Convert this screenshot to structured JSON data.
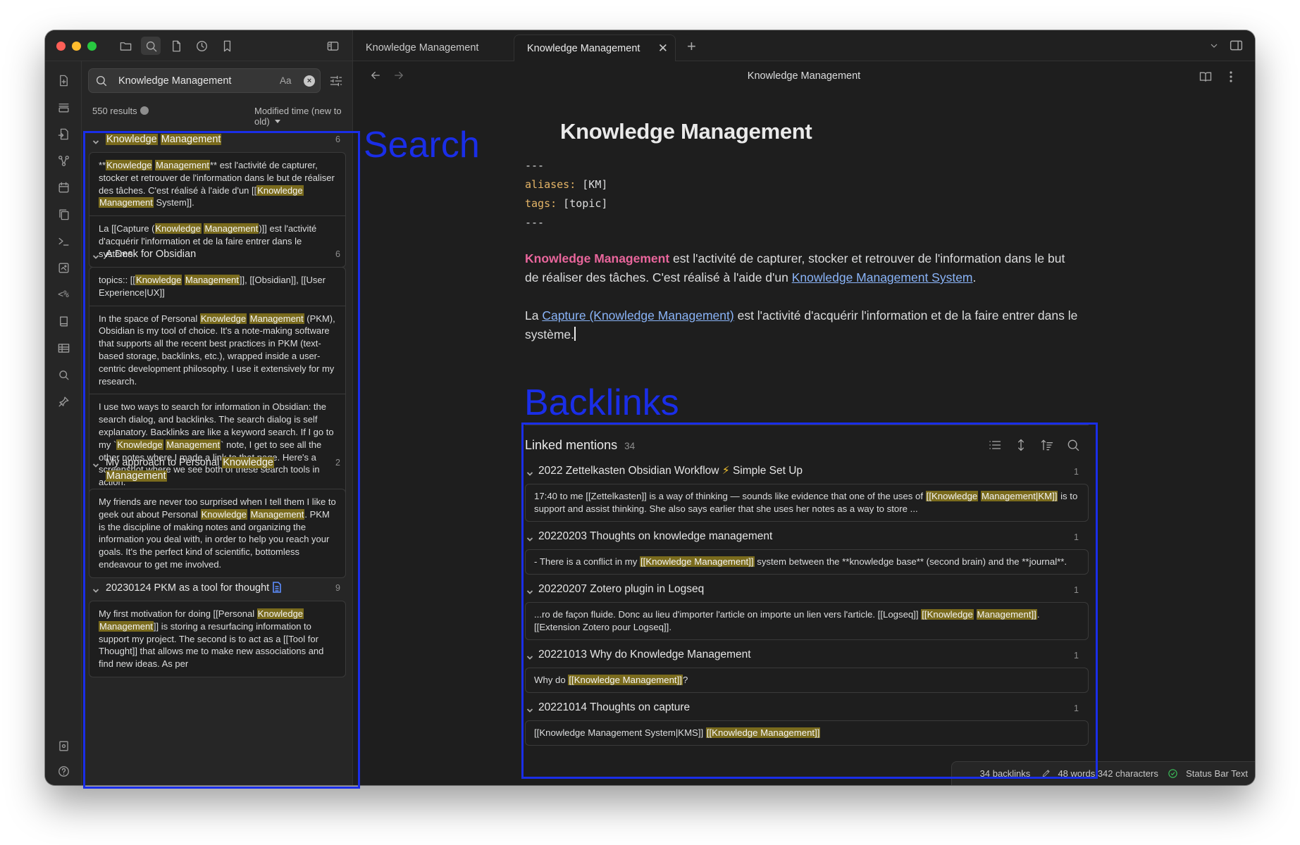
{
  "window": {
    "traffic_lights": [
      "close",
      "minimize",
      "zoom"
    ]
  },
  "toolbar_icons": [
    "folder-icon",
    "search-icon",
    "file-icon",
    "clock-icon",
    "bookmark-icon",
    "sidebar-toggle-icon"
  ],
  "ribbon_icons": [
    "new-note-icon",
    "stack-icon",
    "file-import-icon",
    "graph-icon",
    "calendar-icon",
    "copy-icon",
    "terminal-icon",
    "image-icon",
    "template-icon",
    "book-icon",
    "table-icon",
    "search-icon",
    "pin-icon",
    "vault-icon",
    "help-icon",
    "settings-icon"
  ],
  "search": {
    "query": "Knowledge Management",
    "match_case_label": "Aa",
    "results_count": "550 results",
    "sort_label": "Modified time (new to old)",
    "groups": [
      {
        "title_parts": [
          {
            "hl": true,
            "t": "Knowledge"
          },
          {
            "hl": false,
            "t": " "
          },
          {
            "hl": true,
            "t": "Management"
          }
        ],
        "count": "6",
        "matches": [
          [
            {
              "hl": false,
              "t": "**"
            },
            {
              "hl": true,
              "t": "Knowledge"
            },
            {
              "hl": false,
              "t": " "
            },
            {
              "hl": true,
              "t": "Management"
            },
            {
              "hl": false,
              "t": "** est l'activité de capturer, stocker et retrouver de l'information dans le but de réaliser des tâches. C'est réalisé à l'aide d'un [["
            },
            {
              "hl": true,
              "t": "Knowledge"
            },
            {
              "hl": false,
              "t": " "
            },
            {
              "hl": true,
              "t": "Management"
            },
            {
              "hl": false,
              "t": " System]]."
            }
          ],
          [
            {
              "hl": false,
              "t": "La [[Capture ("
            },
            {
              "hl": true,
              "t": "Knowledge"
            },
            {
              "hl": false,
              "t": " "
            },
            {
              "hl": true,
              "t": "Management"
            },
            {
              "hl": false,
              "t": ")]] est l'activité d'acquérir l'information et de la faire entrer dans le système."
            }
          ]
        ]
      },
      {
        "title_parts": [
          {
            "hl": false,
            "t": "A Desk for Obsidian"
          }
        ],
        "count": "6",
        "matches": [
          [
            {
              "hl": false,
              "t": "topics:: [["
            },
            {
              "hl": true,
              "t": "Knowledge"
            },
            {
              "hl": false,
              "t": " "
            },
            {
              "hl": true,
              "t": "Management"
            },
            {
              "hl": false,
              "t": "]], [[Obsidian]], [[User Experience|UX]]"
            }
          ],
          [
            {
              "hl": false,
              "t": "In the space of Personal "
            },
            {
              "hl": true,
              "t": "Knowledge"
            },
            {
              "hl": false,
              "t": " "
            },
            {
              "hl": true,
              "t": "Management"
            },
            {
              "hl": false,
              "t": " (PKM), Obsidian is my tool of choice. It's a note-making software that supports all the recent best practices in PKM (text-based storage, backlinks, etc.), wrapped inside a user-centric development philosophy. I use it extensively for my research."
            }
          ],
          [
            {
              "hl": false,
              "t": "I use two ways to search for information in Obsidian: the search dialog, and backlinks. The search dialog is self explanatory. Backlinks are like a keyword search. If I go to my `"
            },
            {
              "hl": true,
              "t": "Knowledge"
            },
            {
              "hl": false,
              "t": " "
            },
            {
              "hl": true,
              "t": "Management"
            },
            {
              "hl": false,
              "t": "` note, I get to see all the other notes where I made a link to that page.  Here's a screenshot where we see both of these search tools in action."
            }
          ]
        ]
      },
      {
        "title_parts": [
          {
            "hl": false,
            "t": "My approach to Personal "
          },
          {
            "hl": true,
            "t": "Knowledge"
          },
          {
            "hl": false,
            "t": " "
          },
          {
            "hl": true,
            "t": "Management"
          }
        ],
        "count": "2",
        "matches": [
          [
            {
              "hl": false,
              "t": "My friends are never too surprised when I tell them I like to geek out about Personal "
            },
            {
              "hl": true,
              "t": "Knowledge"
            },
            {
              "hl": false,
              "t": " "
            },
            {
              "hl": true,
              "t": "Management"
            },
            {
              "hl": false,
              "t": ". PKM is the discipline of making notes and organizing the information you deal with, in order to help you reach your goals. It's the perfect kind of scientific, bottomless endeavour to get me involved."
            }
          ]
        ]
      },
      {
        "title_parts": [
          {
            "hl": false,
            "t": "20230124 PKM as a tool for thought"
          }
        ],
        "has_file_icon": true,
        "count": "9",
        "matches": [
          [
            {
              "hl": false,
              "t": "My first motivation for doing [[Personal "
            },
            {
              "hl": true,
              "t": "Knowledge"
            },
            {
              "hl": false,
              "t": " "
            },
            {
              "hl": true,
              "t": "Management"
            },
            {
              "hl": false,
              "t": "]] is storing a resurfacing information to support my project. The second is to act as a [[Tool for Thought]] that allows me to make new associations and find new ideas. As per"
            }
          ]
        ]
      }
    ]
  },
  "tabs": [
    {
      "label": "Knowledge Management",
      "active": false
    },
    {
      "label": "Knowledge Management",
      "active": true
    }
  ],
  "note": {
    "header_title": "Knowledge Management",
    "title": "Knowledge Management",
    "frontmatter": {
      "sep": "---",
      "aliases_key": "aliases:",
      "aliases_val": " [KM]",
      "tags_key": "tags:",
      "tags_val": " [topic]"
    },
    "p1": {
      "bold": "Knowledge Management",
      "text1": " est l'activité de capturer, stocker et retrouver de l'information dans le but de réaliser des tâches. C'est réalisé à l'aide d'un ",
      "link": "Knowledge Management System",
      "text2": "."
    },
    "p2": {
      "text1": "La ",
      "link": "Capture (Knowledge Management)",
      "text2": " est l'activité d'acquérir l'information et de la faire entrer dans le système."
    }
  },
  "backlinks": {
    "title": "Linked mentions",
    "count": "34",
    "tool_icons": [
      "list-icon",
      "expand-icon",
      "sort-icon",
      "search-icon"
    ],
    "groups": [
      {
        "title": "2022 Zettelkasten Obsidian Workflow ",
        "emoji": "⚡",
        "title2": " Simple Set Up",
        "count": "1",
        "parts": [
          {
            "hl": false,
            "t": "17:40 to me [[Zettelkasten]] is a way of thinking — sounds like evidence that one of the uses of "
          },
          {
            "hl": true,
            "t": "[[Knowledge"
          },
          {
            "hl": false,
            "t": " "
          },
          {
            "hl": true,
            "t": "Management|KM]]"
          },
          {
            "hl": false,
            "t": " is to support and assist thinking. She also says earlier that she uses her notes as a way to store ..."
          }
        ]
      },
      {
        "title": "20220203 Thoughts on knowledge management",
        "count": "1",
        "parts": [
          {
            "hl": false,
            "t": "- There is a conflict in my "
          },
          {
            "hl": true,
            "t": "[[Knowledge Management]]"
          },
          {
            "hl": false,
            "t": " system between the **knowledge base** (second brain) and the **journal**."
          }
        ]
      },
      {
        "title": "20220207 Zotero plugin in Logseq",
        "count": "1",
        "parts": [
          {
            "hl": false,
            "t": "...ro de façon fluide. Donc au lieu d'importer l'article on importe un lien vers l'article. [[Logseq]] "
          },
          {
            "hl": true,
            "t": "[[Knowledge"
          },
          {
            "hl": false,
            "t": " "
          },
          {
            "hl": true,
            "t": "Management]]"
          },
          {
            "hl": false,
            "t": ". [[Extension Zotero pour Logseq]]."
          }
        ]
      },
      {
        "title": "20221013 Why do Knowledge Management",
        "count": "1",
        "parts": [
          {
            "hl": false,
            "t": "Why do "
          },
          {
            "hl": true,
            "t": "[[Knowledge Management]]"
          },
          {
            "hl": false,
            "t": "?"
          }
        ]
      },
      {
        "title": "20221014 Thoughts on capture",
        "count": "1",
        "parts": [
          {
            "hl": false,
            "t": "[[Knowledge Management System|KMS]] "
          },
          {
            "hl": true,
            "t": "[[Knowledge Management]]"
          }
        ]
      }
    ]
  },
  "status": {
    "backlinks": "34 backlinks",
    "words": "48 words",
    "characters": "342 characters",
    "custom": "Status Bar Text"
  },
  "annotations": {
    "search_label": "Search",
    "backlinks_label": "Backlinks",
    "color": "#1a2ee8"
  },
  "colors": {
    "highlight": "#7a6b1d",
    "link": "#8ab4f8",
    "bold_pink": "#e9669c",
    "frontmatter_key": "#e5b567"
  }
}
